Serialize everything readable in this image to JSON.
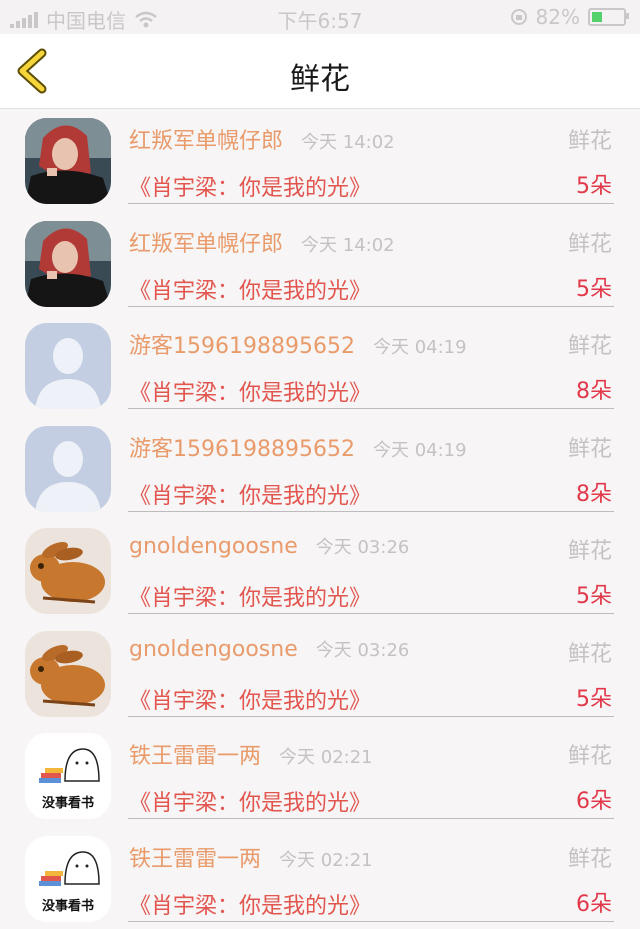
{
  "status_bar": {
    "carrier": "中国电信",
    "time": "下午6:57",
    "battery": "82%"
  },
  "header": {
    "title": "鲜花"
  },
  "rows": [
    {
      "name": "红叛军单幌仔郎",
      "time": "今天 14:02",
      "type": "鲜花",
      "book": "《肖宇梁：你是我的光》",
      "count": "5朵",
      "avatar": "woman-photo"
    },
    {
      "name": "红叛军单幌仔郎",
      "time": "今天 14:02",
      "type": "鲜花",
      "book": "《肖宇梁：你是我的光》",
      "count": "5朵",
      "avatar": "woman-photo"
    },
    {
      "name": "游客1596198895652",
      "time": "今天 04:19",
      "type": "鲜花",
      "book": "《肖宇梁：你是我的光》",
      "count": "8朵",
      "avatar": "default-user"
    },
    {
      "name": "游客1596198895652",
      "time": "今天 04:19",
      "type": "鲜花",
      "book": "《肖宇梁：你是我的光》",
      "count": "8朵",
      "avatar": "default-user"
    },
    {
      "name": "gnoldengoosne",
      "time": "今天 03:26",
      "type": "鲜花",
      "book": "《肖宇梁：你是我的光》",
      "count": "5朵",
      "avatar": "rabbit-photo"
    },
    {
      "name": "gnoldengoosne",
      "time": "今天 03:26",
      "type": "鲜花",
      "book": "《肖宇梁：你是我的光》",
      "count": "5朵",
      "avatar": "rabbit-photo"
    },
    {
      "name": "铁王雷雷一两",
      "time": "今天 02:21",
      "type": "鲜花",
      "book": "《肖宇梁：你是我的光》",
      "count": "6朵",
      "avatar": "cartoon",
      "avatar_caption": "没事看书"
    },
    {
      "name": "铁王雷雷一两",
      "time": "今天 02:21",
      "type": "鲜花",
      "book": "《肖宇梁：你是我的光》",
      "count": "6朵",
      "avatar": "cartoon",
      "avatar_caption": "没事看书"
    }
  ]
}
